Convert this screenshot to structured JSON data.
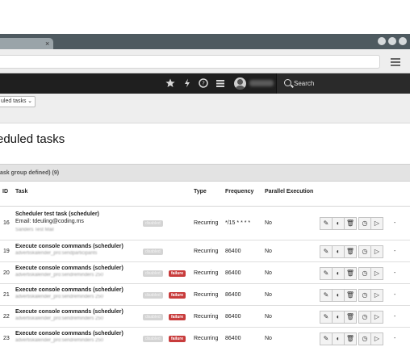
{
  "browser": {
    "tab_close": "×"
  },
  "topbar": {
    "search_label": "Search",
    "icons": [
      "star-icon",
      "bolt-icon",
      "help-icon",
      "list-icon",
      "user-icon"
    ]
  },
  "module": {
    "function_select": "uled tasks",
    "heading": "eduled tasks"
  },
  "panel": {
    "group_title": "ask group defined) (9)",
    "columns": [
      "ID",
      "Task",
      "Type",
      "Frequency",
      "Parallel Execution"
    ]
  },
  "tasks": [
    {
      "id": "16",
      "title": "Scheduler test task (scheduler)",
      "subtitle": "Email: tdeuling@coding.ms",
      "detail": "Sanders Test Mail",
      "status": [
        "disabled"
      ],
      "type": "Recurring",
      "frequency": "*/15 * * * *",
      "parallel": "No",
      "last": "-"
    },
    {
      "id": "19",
      "title": "Execute console commands (scheduler)",
      "subtitle": "",
      "detail": "advertiskalender_pro:sendparticipants",
      "status": [
        "disabled"
      ],
      "type": "Recurring",
      "frequency": "86400",
      "parallel": "No",
      "last": "-"
    },
    {
      "id": "20",
      "title": "Execute console commands (scheduler)",
      "subtitle": "",
      "detail": "advertiskalender_pro:sendreminders 250",
      "status": [
        "disabled",
        "failure"
      ],
      "type": "Recurring",
      "frequency": "86400",
      "parallel": "No",
      "last": "-"
    },
    {
      "id": "21",
      "title": "Execute console commands (scheduler)",
      "subtitle": "",
      "detail": "advertiskalender_pro:sendreminders 250",
      "status": [
        "disabled",
        "failure"
      ],
      "type": "Recurring",
      "frequency": "86400",
      "parallel": "No",
      "last": "-"
    },
    {
      "id": "22",
      "title": "Execute console commands (scheduler)",
      "subtitle": "",
      "detail": "advertiskalender_pro:sendreminders 250",
      "status": [
        "disabled",
        "failure"
      ],
      "type": "Recurring",
      "frequency": "86400",
      "parallel": "No",
      "last": "-"
    },
    {
      "id": "23",
      "title": "Execute console commands (scheduler)",
      "subtitle": "",
      "detail": "advertiskalender_pro:sendreminders 250",
      "status": [
        "disabled",
        "failure"
      ],
      "type": "Recurring",
      "frequency": "86400",
      "parallel": "No",
      "last": "-"
    }
  ],
  "action_icons": {
    "edit": "✎",
    "toggle": "◐",
    "delete": "🗑",
    "history": "◷",
    "run": "▷"
  }
}
